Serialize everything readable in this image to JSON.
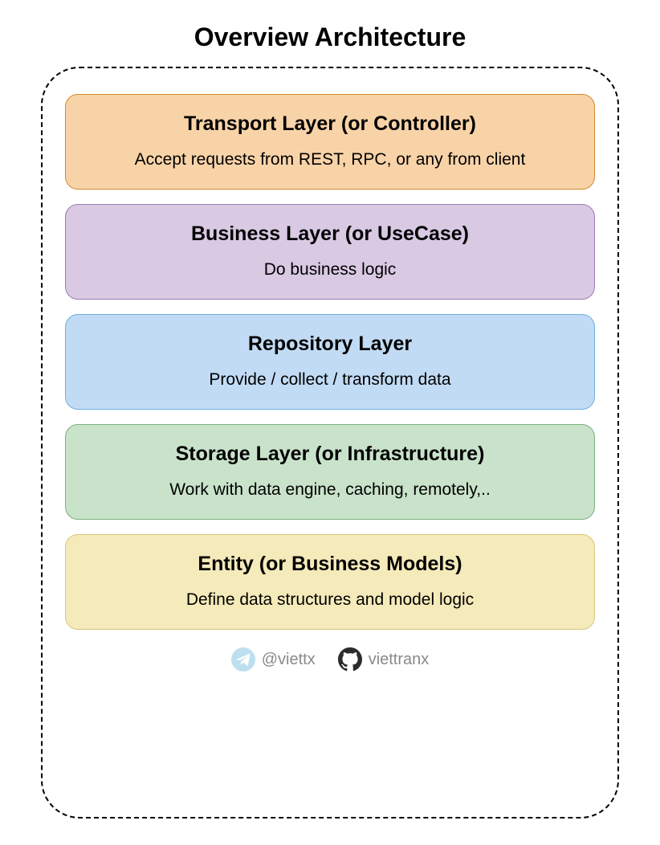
{
  "title": "Overview Architecture",
  "layers": [
    {
      "title": "Transport Layer (or Controller)",
      "description": "Accept requests from REST, RPC,  or any from client",
      "color": "orange"
    },
    {
      "title": "Business Layer (or UseCase)",
      "description": "Do business logic",
      "color": "purple"
    },
    {
      "title": "Repository Layer",
      "description": "Provide / collect / transform data",
      "color": "blue"
    },
    {
      "title": "Storage Layer (or Infrastructure)",
      "description": "Work with data engine, caching, remotely,..",
      "color": "green"
    },
    {
      "title": "Entity (or Business Models)",
      "description": "Define data structures and model logic",
      "color": "yellow"
    }
  ],
  "footer": {
    "telegram": "@viettx",
    "github": "viettranx"
  }
}
